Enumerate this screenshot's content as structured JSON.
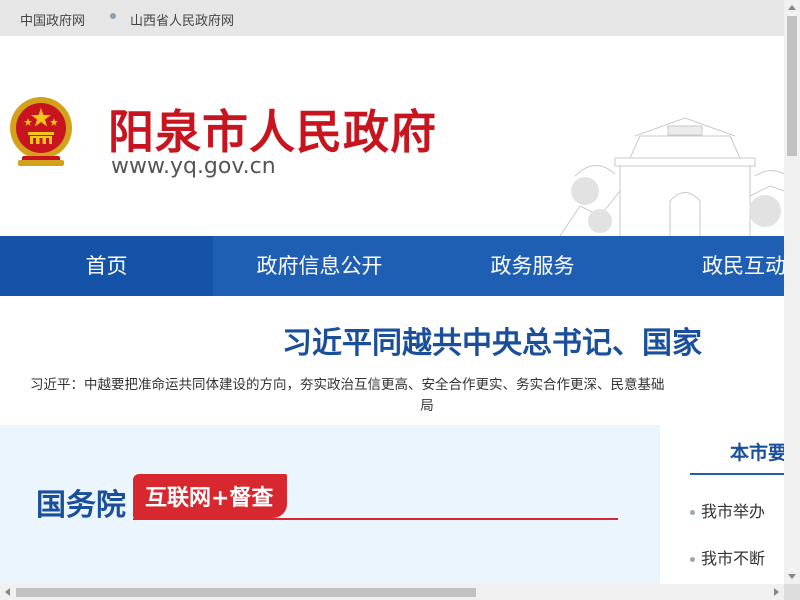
{
  "topbar": {
    "links": [
      "中国政府网",
      "山西省人民政府网"
    ]
  },
  "header": {
    "title": "阳泉市人民政府",
    "url": "www.yq.gov.cn",
    "emblem_icon": "national-emblem-icon",
    "landmark_image": "city-gate-illustration"
  },
  "nav": {
    "items": [
      "首页",
      "政府信息公开",
      "政务服务",
      "政民互动"
    ],
    "active_index": 0
  },
  "headline": {
    "title": "习近平同越共中央总书记、国家",
    "summary_line1": "习近平：中越要把准命运共同体建设的方向，夯实政治互信更高、安全合作更实、务实合作更深、民意基础",
    "summary_line2": "局"
  },
  "feature": {
    "title": "国务院",
    "badge": "互联网+督查"
  },
  "news": {
    "header": "本市要",
    "items": [
      "我市举办",
      "我市不断"
    ]
  },
  "colors": {
    "brand_red": "#c8141e",
    "nav_blue": "#1e5fb3",
    "headline_blue": "#1a4f9c",
    "panel_bg": "#ebf5fd"
  }
}
